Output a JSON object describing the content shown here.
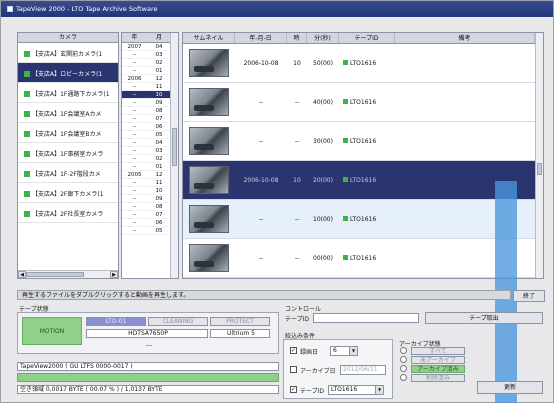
{
  "window": {
    "title": "TapeView 2000 - LTO Tape Archive Software"
  },
  "camera_panel": {
    "header": "カメラ",
    "items": [
      "【支店A】玄関前カメラ(1",
      "【支店A】ロビーカメラ(1",
      "【支店A】1F通路下カメラ(1",
      "【支店A】1F会議室Aカメ",
      "【支店A】1F会議室Bカメ",
      "【支店A】1F事務室カメラ",
      "【支店A】1F-2F階段カメ",
      "【支店A】2F廊下カメラ(1",
      "【支店A】2F社長室カメラ"
    ],
    "selected_index": 1
  },
  "yearmonth_panel": {
    "year_header": "年",
    "month_header": "月",
    "rows": [
      {
        "year": "2007",
        "month": "04"
      },
      {
        "year": "--",
        "month": "03"
      },
      {
        "year": "--",
        "month": "02"
      },
      {
        "year": "--",
        "month": "01"
      },
      {
        "year": "2006",
        "month": "12"
      },
      {
        "year": "--",
        "month": "11"
      },
      {
        "year": "--",
        "month": "10"
      },
      {
        "year": "--",
        "month": "09"
      },
      {
        "year": "--",
        "month": "08"
      },
      {
        "year": "--",
        "month": "07"
      },
      {
        "year": "--",
        "month": "06"
      },
      {
        "year": "--",
        "month": "05"
      },
      {
        "year": "--",
        "month": "04"
      },
      {
        "year": "--",
        "month": "03"
      },
      {
        "year": "--",
        "month": "02"
      },
      {
        "year": "--",
        "month": "01"
      },
      {
        "year": "2005",
        "month": "12"
      },
      {
        "year": "--",
        "month": "11"
      },
      {
        "year": "--",
        "month": "10"
      },
      {
        "year": "--",
        "month": "09"
      },
      {
        "year": "--",
        "month": "08"
      },
      {
        "year": "--",
        "month": "07"
      },
      {
        "year": "--",
        "month": "06"
      },
      {
        "year": "--",
        "month": "05"
      }
    ],
    "selected_index": 6
  },
  "grid": {
    "headers": {
      "thumb": "サムネイル",
      "date": "年-月-日",
      "hour": "時",
      "duration": "分(秒)",
      "tape": "テープID",
      "note": "備考"
    },
    "rows": [
      {
        "date": "2006-10-08",
        "hour": "10",
        "duration": "50(00)",
        "tape": "LTO1616"
      },
      {
        "date": "--",
        "hour": "--",
        "duration": "40(00)",
        "tape": "LTO1616"
      },
      {
        "date": "--",
        "hour": "--",
        "duration": "30(00)",
        "tape": "LTO1616"
      },
      {
        "date": "2006-10-08",
        "hour": "10",
        "duration": "20(00)",
        "tape": "LTO1616"
      },
      {
        "date": "--",
        "hour": "--",
        "duration": "10(00)",
        "tape": "LTO1616"
      },
      {
        "date": "--",
        "hour": "--",
        "duration": "00(00)",
        "tape": "LTO1616"
      }
    ],
    "selected_index": 3
  },
  "status": {
    "message": "再生するファイルをダブルクリックすると動画を再生します。",
    "end_button": "終了"
  },
  "tape_status": {
    "title": "テープ状態",
    "motion": "MOTION",
    "lto": "LTO-01",
    "cleaning": "CLEANING",
    "protect": "PROTECT",
    "drive": "HDTSA7650P",
    "type": "Ultrium 5",
    "dash": "---",
    "device": "TapeView2000 ( GU LTFS 0000-0017 )",
    "capacity": "空き領域 0,0017 BYTE ( 00.07 % ) / 1,0137 BYTE"
  },
  "control": {
    "title": "コントロール",
    "tape_id_label": "テープID",
    "eject_button": "テープ取出"
  },
  "search": {
    "title": "絞込み条件",
    "record_day_label": "録画日",
    "record_day_value": "6",
    "archive_day_label": "アーカイブ日",
    "archive_day_value": "2012/06/11",
    "tape_id_label": "テープID",
    "tape_id_value": "LTO1616"
  },
  "archive_state": {
    "title": "アーカイブ状態",
    "options": [
      "すべて",
      "未アーカイブ",
      "アーカイブ済み",
      "削除済み"
    ],
    "update_button": "更新"
  }
}
